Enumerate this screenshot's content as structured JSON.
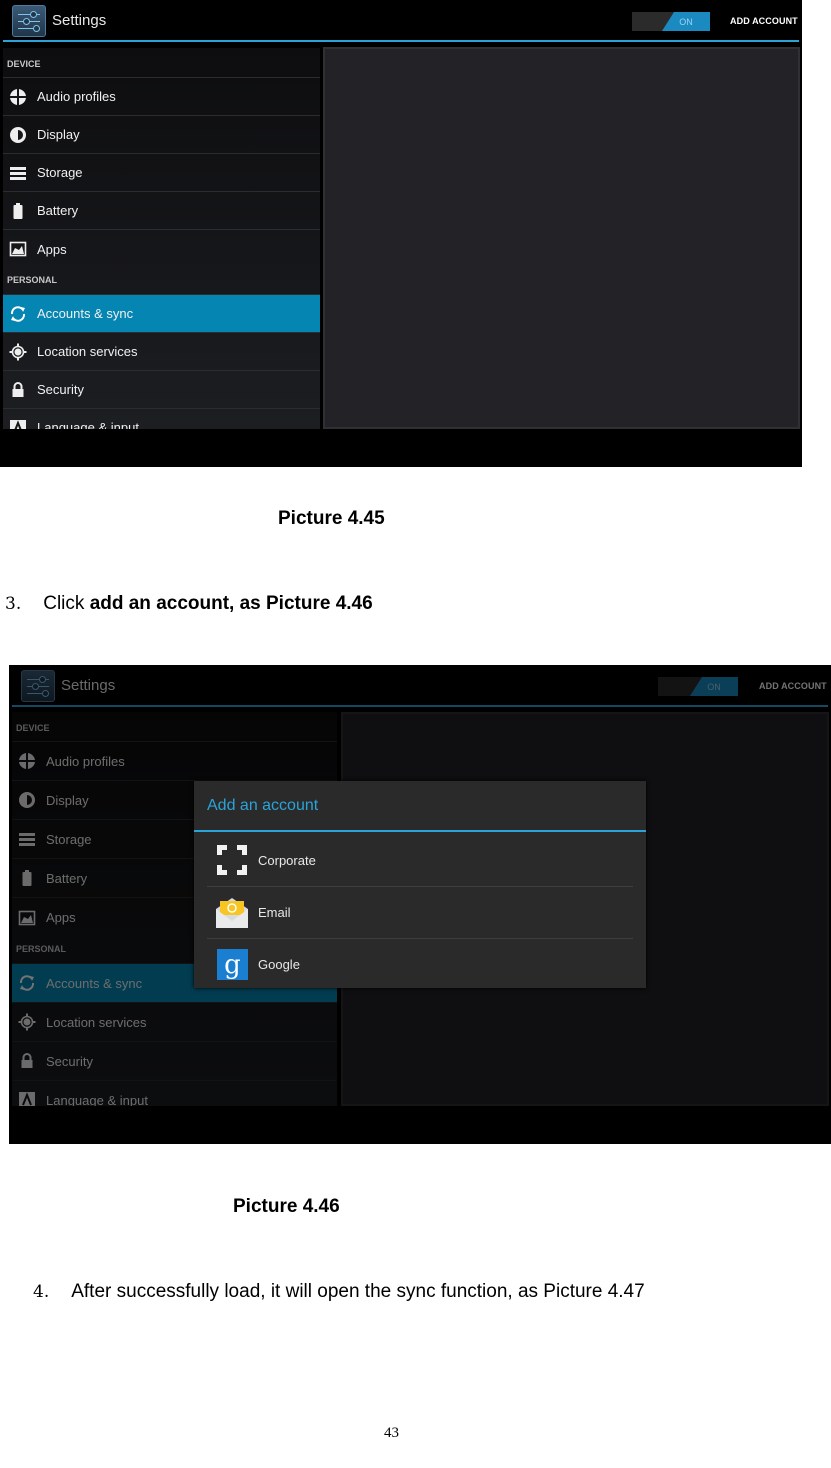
{
  "picture_45": {
    "app_title": "Settings",
    "toggle_label": "ON",
    "add_account_label": "ADD ACCOUNT",
    "sections": {
      "device": "DEVICE",
      "personal": "PERSONAL"
    },
    "device_items": [
      {
        "label": "Audio profiles",
        "icon": "audio-profiles-icon"
      },
      {
        "label": "Display",
        "icon": "display-brightness-icon"
      },
      {
        "label": "Storage",
        "icon": "storage-icon"
      },
      {
        "label": "Battery",
        "icon": "battery-icon"
      },
      {
        "label": "Apps",
        "icon": "apps-icon"
      }
    ],
    "personal_items": [
      {
        "label": "Accounts & sync",
        "icon": "sync-icon",
        "selected": true
      },
      {
        "label": "Location services",
        "icon": "location-icon"
      },
      {
        "label": "Security",
        "icon": "lock-icon"
      },
      {
        "label": "Language & input",
        "icon": "language-icon"
      }
    ],
    "caption": "Picture 4.45"
  },
  "step3": {
    "number": "3.",
    "prefix": "Click ",
    "bold": "add an account, as Picture 4.46"
  },
  "picture_46": {
    "app_title": "Settings",
    "toggle_label": "ON",
    "add_account_label": "ADD ACCOUNT",
    "sections": {
      "device": "DEVICE",
      "personal": "PERSONAL"
    },
    "device_items": [
      {
        "label": "Audio profiles"
      },
      {
        "label": "Display"
      },
      {
        "label": "Storage"
      },
      {
        "label": "Battery"
      },
      {
        "label": "Apps"
      }
    ],
    "personal_items": [
      {
        "label": "Accounts & sync",
        "selected": true
      },
      {
        "label": "Location services"
      },
      {
        "label": "Security"
      },
      {
        "label": "Language & input"
      }
    ],
    "dialog": {
      "title": "Add an account",
      "options": [
        {
          "label": "Corporate",
          "icon": "corporate-exchange-icon"
        },
        {
          "label": "Email",
          "icon": "email-envelope-icon"
        },
        {
          "label": "Google",
          "icon": "google-g-icon"
        }
      ]
    },
    "caption": "Picture 4.46"
  },
  "step4": {
    "number": "4.",
    "text": "After successfully load, it will open the sync function, as Picture 4.47"
  },
  "page_number": "43",
  "colors": {
    "accent": "#2ba3d8",
    "selected_row": "#0585b2",
    "google_blue": "#1a7fd0",
    "email_yellow": "#f7c625"
  }
}
